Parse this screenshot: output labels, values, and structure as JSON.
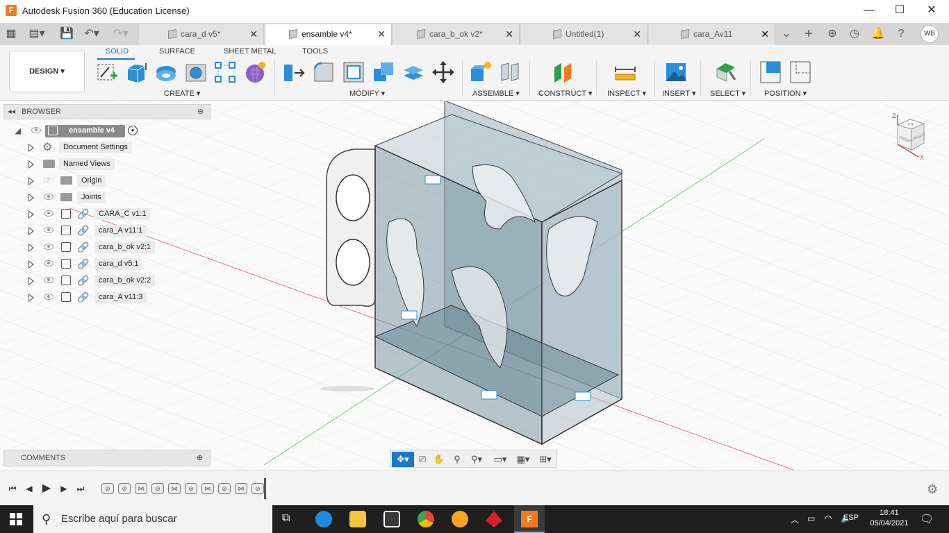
{
  "window": {
    "title": "Autodesk Fusion 360 (Education License)",
    "logo_letter": "F",
    "minimize": "—",
    "maximize": "☐",
    "close": "✕"
  },
  "tabs": [
    {
      "label": "cara_d v5*",
      "close": "✕"
    },
    {
      "label": "ensamble v4*",
      "close": "✕"
    },
    {
      "label": "cara_b_ok v2*",
      "close": "✕"
    },
    {
      "label": "Untitled(1)",
      "close": "✕"
    },
    {
      "label": "cara_Av11",
      "close": "✕"
    }
  ],
  "tabbar_right": {
    "user_initials": "WB"
  },
  "ribbon": {
    "workspace": "DESIGN ▾",
    "tabs": [
      "SOLID",
      "SURFACE",
      "SHEET METAL",
      "TOOLS"
    ],
    "groups": {
      "create": "CREATE ▾",
      "modify": "MODIFY ▾",
      "assemble": "ASSEMBLE ▾",
      "construct": "CONSTRUCT ▾",
      "inspect": "INSPECT ▾",
      "insert": "INSERT ▾",
      "select": "SELECT ▾",
      "position": "POSITION ▾"
    }
  },
  "browser": {
    "header": "BROWSER",
    "root": "ensamble v4",
    "items": [
      {
        "label": "Document Settings",
        "icon": "gear-icon"
      },
      {
        "label": "Named Views",
        "icon": "folder-icon"
      },
      {
        "label": "Origin",
        "icon": "folder-icon"
      },
      {
        "label": "Joints",
        "icon": "folder-icon"
      },
      {
        "label": "CARA_C v1:1",
        "icon": "component-icon"
      },
      {
        "label": "cara_A v11:1",
        "icon": "component-icon"
      },
      {
        "label": "cara_b_ok v2:1",
        "icon": "component-icon"
      },
      {
        "label": "cara_d v5:1",
        "icon": "component-icon"
      },
      {
        "label": "cara_b_ok v2:2",
        "icon": "component-icon"
      },
      {
        "label": "cara_A v11:3",
        "icon": "component-icon"
      }
    ]
  },
  "comments": {
    "header": "COMMENTS"
  },
  "viewcube": {
    "top": "TOP",
    "front": "FRONT",
    "right": "RIGHT",
    "axis_z": "Z",
    "axis_x": "X"
  },
  "taskbar": {
    "search_placeholder": "Escribe aquí para buscar",
    "language": "ESP",
    "time": "18:41",
    "date": "05/04/2021"
  },
  "colors": {
    "accent": "#1a7ac9",
    "model_fill": "#7a9aa8",
    "grid_red": "#e06666",
    "grid_green": "#66cc66"
  }
}
